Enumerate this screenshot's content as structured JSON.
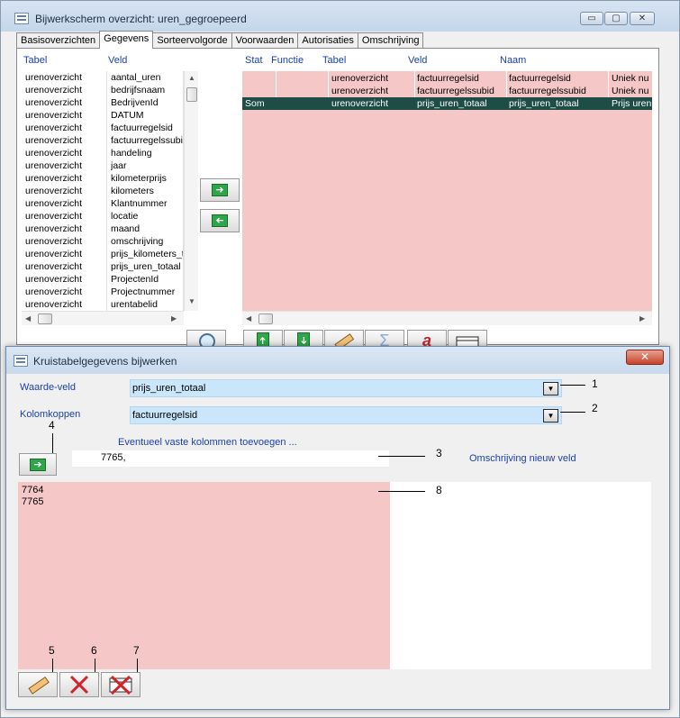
{
  "main_window": {
    "title": "Bijwerkscherm overzicht: uren_gegroepeerd",
    "controls": {
      "minimize": "▭",
      "maximize": "▢",
      "close": "✕"
    },
    "tabs": [
      {
        "label": "Basisoverzichten",
        "active": false
      },
      {
        "label": "Gegevens",
        "active": true
      },
      {
        "label": "Sorteervolgorde",
        "active": false
      },
      {
        "label": "Voorwaarden",
        "active": false
      },
      {
        "label": "Autorisaties",
        "active": false
      },
      {
        "label": "Omschrijving",
        "active": false
      }
    ],
    "field_list": {
      "headers": {
        "table": "Tabel",
        "field": "Veld"
      },
      "rows": [
        {
          "table": "urenoverzicht",
          "field": "aantal_uren"
        },
        {
          "table": "urenoverzicht",
          "field": "bedrijfsnaam"
        },
        {
          "table": "urenoverzicht",
          "field": "BedrijvenId"
        },
        {
          "table": "urenoverzicht",
          "field": "DATUM"
        },
        {
          "table": "urenoverzicht",
          "field": "factuurregelsid"
        },
        {
          "table": "urenoverzicht",
          "field": "factuurregelssubid"
        },
        {
          "table": "urenoverzicht",
          "field": "handeling"
        },
        {
          "table": "urenoverzicht",
          "field": "jaar"
        },
        {
          "table": "urenoverzicht",
          "field": "kilometerprijs"
        },
        {
          "table": "urenoverzicht",
          "field": "kilometers"
        },
        {
          "table": "urenoverzicht",
          "field": "Klantnummer"
        },
        {
          "table": "urenoverzicht",
          "field": "locatie"
        },
        {
          "table": "urenoverzicht",
          "field": "maand"
        },
        {
          "table": "urenoverzicht",
          "field": "omschrijving"
        },
        {
          "table": "urenoverzicht",
          "field": "prijs_kilometers_totaal"
        },
        {
          "table": "urenoverzicht",
          "field": "prijs_uren_totaal"
        },
        {
          "table": "urenoverzicht",
          "field": "ProjectenId"
        },
        {
          "table": "urenoverzicht",
          "field": "Projectnummer"
        },
        {
          "table": "urenoverzicht",
          "field": "urentabelid"
        }
      ]
    },
    "grid": {
      "headers": {
        "stat": "Stat",
        "function": "Functie",
        "table": "Tabel",
        "field": "Veld",
        "name": "Naam"
      },
      "rows": [
        {
          "stat": "",
          "function": "",
          "table": "urenoverzicht",
          "field": "factuurregelsid",
          "name": "factuurregelsid",
          "desc": "Uniek nu"
        },
        {
          "stat": "",
          "function": "",
          "table": "urenoverzicht",
          "field": "factuurregelssubid",
          "name": "factuurregelssubid",
          "desc": "Uniek nu"
        },
        {
          "stat": "Som",
          "function": "",
          "table": "urenoverzicht",
          "field": "prijs_uren_totaal",
          "name": "prijs_uren_totaal",
          "desc": "Prijs uren"
        }
      ]
    },
    "toolbar_icons": [
      "search-icon",
      "move-up-icon",
      "move-down-icon",
      "edit-pencil-icon",
      "sigma-icon",
      "text-format-icon",
      "crosstab-icon"
    ]
  },
  "dialog": {
    "title": "Kruistabelgegevens bijwerken",
    "close": "✕",
    "value_field": {
      "label": "Waarde-veld",
      "value": "prijs_uren_totaal"
    },
    "column_headers": {
      "label": "Kolomkoppen",
      "value": "factuurregelsid"
    },
    "fixed_columns_hint": "Eventueel vaste kolommen toevoegen ...",
    "fixed_columns_value": "7765,",
    "new_field_label": "Omschrijving nieuw veld",
    "values_list": [
      "7764",
      "7765"
    ],
    "callouts": [
      "1",
      "2",
      "3",
      "4",
      "5",
      "6",
      "7",
      "8"
    ]
  },
  "colors": {
    "pink": "#f6c7c7",
    "blue_field": "#c9e6fb",
    "selected_row": "#1d4d46",
    "label_blue": "#1a3fa8"
  }
}
